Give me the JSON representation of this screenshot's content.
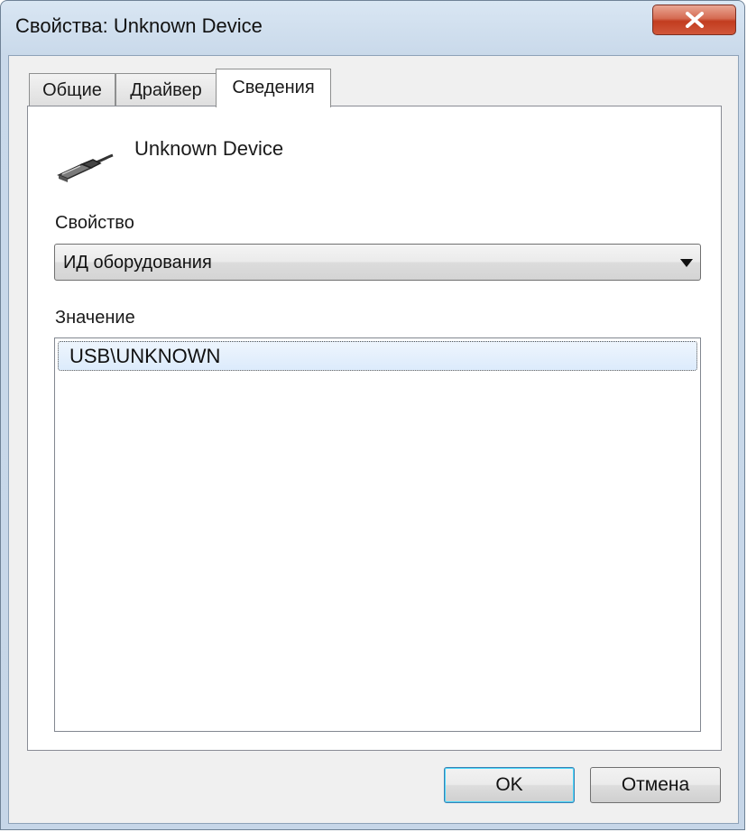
{
  "window": {
    "title": "Свойства: Unknown Device",
    "close_icon": "close-icon"
  },
  "tabs": [
    {
      "label": "Общие",
      "active": false
    },
    {
      "label": "Драйвер",
      "active": false
    },
    {
      "label": "Сведения",
      "active": true
    }
  ],
  "details": {
    "device_icon": "usb-plug-icon",
    "device_name": "Unknown Device",
    "property_label": "Свойство",
    "property_selected": "ИД оборудования",
    "value_label": "Значение",
    "values": [
      "USB\\UNKNOWN"
    ]
  },
  "buttons": {
    "ok": "OK",
    "cancel": "Отмена"
  },
  "colors": {
    "title_bg": "#d9e6f3",
    "close_button": "#c23c1f",
    "selection": "#dcebfc"
  }
}
